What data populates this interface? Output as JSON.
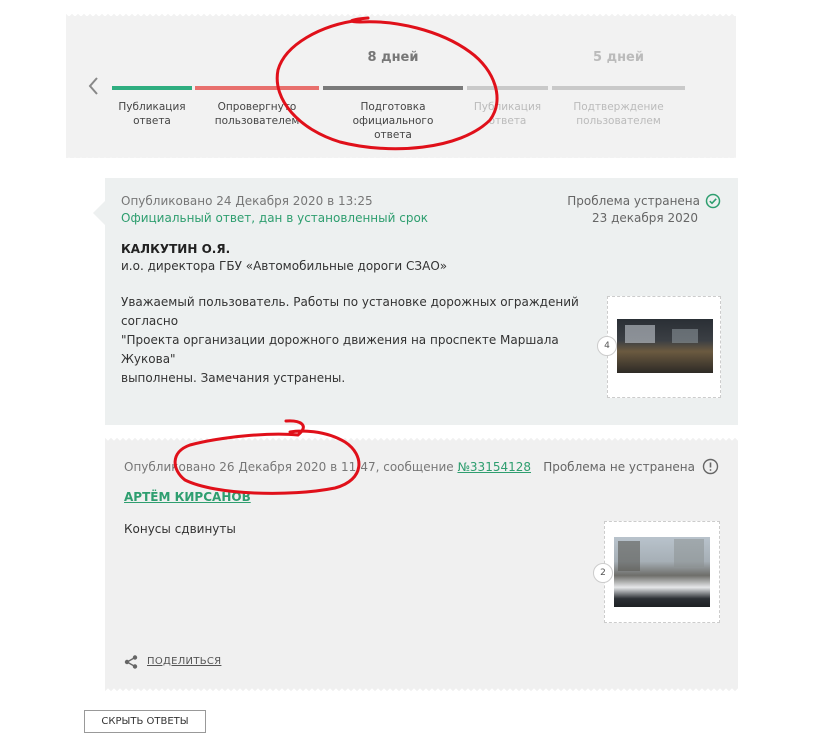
{
  "timeline": {
    "stages": [
      {
        "label_1": "Публикация",
        "label_2": "ответа",
        "days": "",
        "bar_color": "#2fae80",
        "muted": false
      },
      {
        "label_1": "Опровергнуто",
        "label_2": "пользователем",
        "days": "",
        "bar_color": "#e8706d",
        "muted": false
      },
      {
        "label_1": "Подготовка официального",
        "label_2": "ответа",
        "days": "8 дней",
        "bar_color": "#7a7a7a",
        "muted": false
      },
      {
        "label_1": "Публикация",
        "label_2": "ответа",
        "days": "",
        "bar_color": "#c9c9c9",
        "muted": true
      },
      {
        "label_1": "Подтверждение",
        "label_2": "пользователем",
        "days": "5 дней",
        "bar_color": "#c9c9c9",
        "muted": true
      }
    ]
  },
  "official_response": {
    "published": "Опубликовано 24 Декабря 2020 в 13:25",
    "type_note": "Официальный ответ, дан в установленный срок",
    "status": "Проблема устранена",
    "status_date": "23 декабря 2020",
    "status_icon": "check-circle-icon",
    "status_color": "#2e9e6f",
    "author_name": "КАЛКУТИН О.Я.",
    "author_title": "и.о. директора ГБУ «Автомобильные дороги СЗАО»",
    "text_line_1": "Уважаемый пользователь. Работы по установке дорожных ограждений согласно",
    "text_line_2": "\"Проекта организации дорожного движения на проспекте Маршала Жукова\"",
    "text_line_3": "выполнены. Замечания устранены.",
    "photo_count": "4"
  },
  "user_response": {
    "published_prefix": "Опубликовано 26 Декабря 2020 в 11:47, сообщение ",
    "message_link": "№33154128",
    "status": "Проблема не устранена",
    "status_icon": "exclamation-circle-icon",
    "author_name": "АРТЁМ КИРСАНОВ",
    "text": "Конусы сдвинуты",
    "photo_count": "2",
    "share_label": "ПОДЕЛИТЬСЯ"
  },
  "hide_button_label": "СКРЫТЬ ОТВЕТЫ",
  "colors": {
    "accent_green": "#2e9e6f",
    "annotation_red": "#e0101a"
  }
}
